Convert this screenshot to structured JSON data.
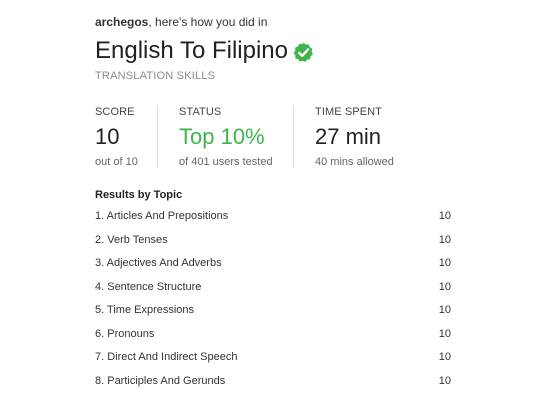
{
  "header": {
    "username": "archegos",
    "greeting_suffix": ", here's how you did in",
    "title": "English To Filipino",
    "subtitle": "TRANSLATION SKILLS",
    "verified_icon": "check-circle-icon",
    "verified_color": "#3db54a"
  },
  "stats": {
    "score": {
      "label": "SCORE",
      "value": "10",
      "note": "out of 10"
    },
    "status": {
      "label": "STATUS",
      "value": "Top 10%",
      "note": "of 401 users tested"
    },
    "time": {
      "label": "TIME SPENT",
      "value": "27 min",
      "note": "40 mins allowed"
    }
  },
  "topics": {
    "heading": "Results by Topic",
    "items": [
      {
        "name": "1. Articles And Prepositions",
        "score": "10"
      },
      {
        "name": "2. Verb Tenses",
        "score": "10"
      },
      {
        "name": "3. Adjectives And Adverbs",
        "score": "10"
      },
      {
        "name": "4. Sentence Structure",
        "score": "10"
      },
      {
        "name": "5. Time Expressions",
        "score": "10"
      },
      {
        "name": "6. Pronouns",
        "score": "10"
      },
      {
        "name": "7. Direct And Indirect Speech",
        "score": "10"
      },
      {
        "name": "8. Participles And Gerunds",
        "score": "10"
      }
    ]
  }
}
